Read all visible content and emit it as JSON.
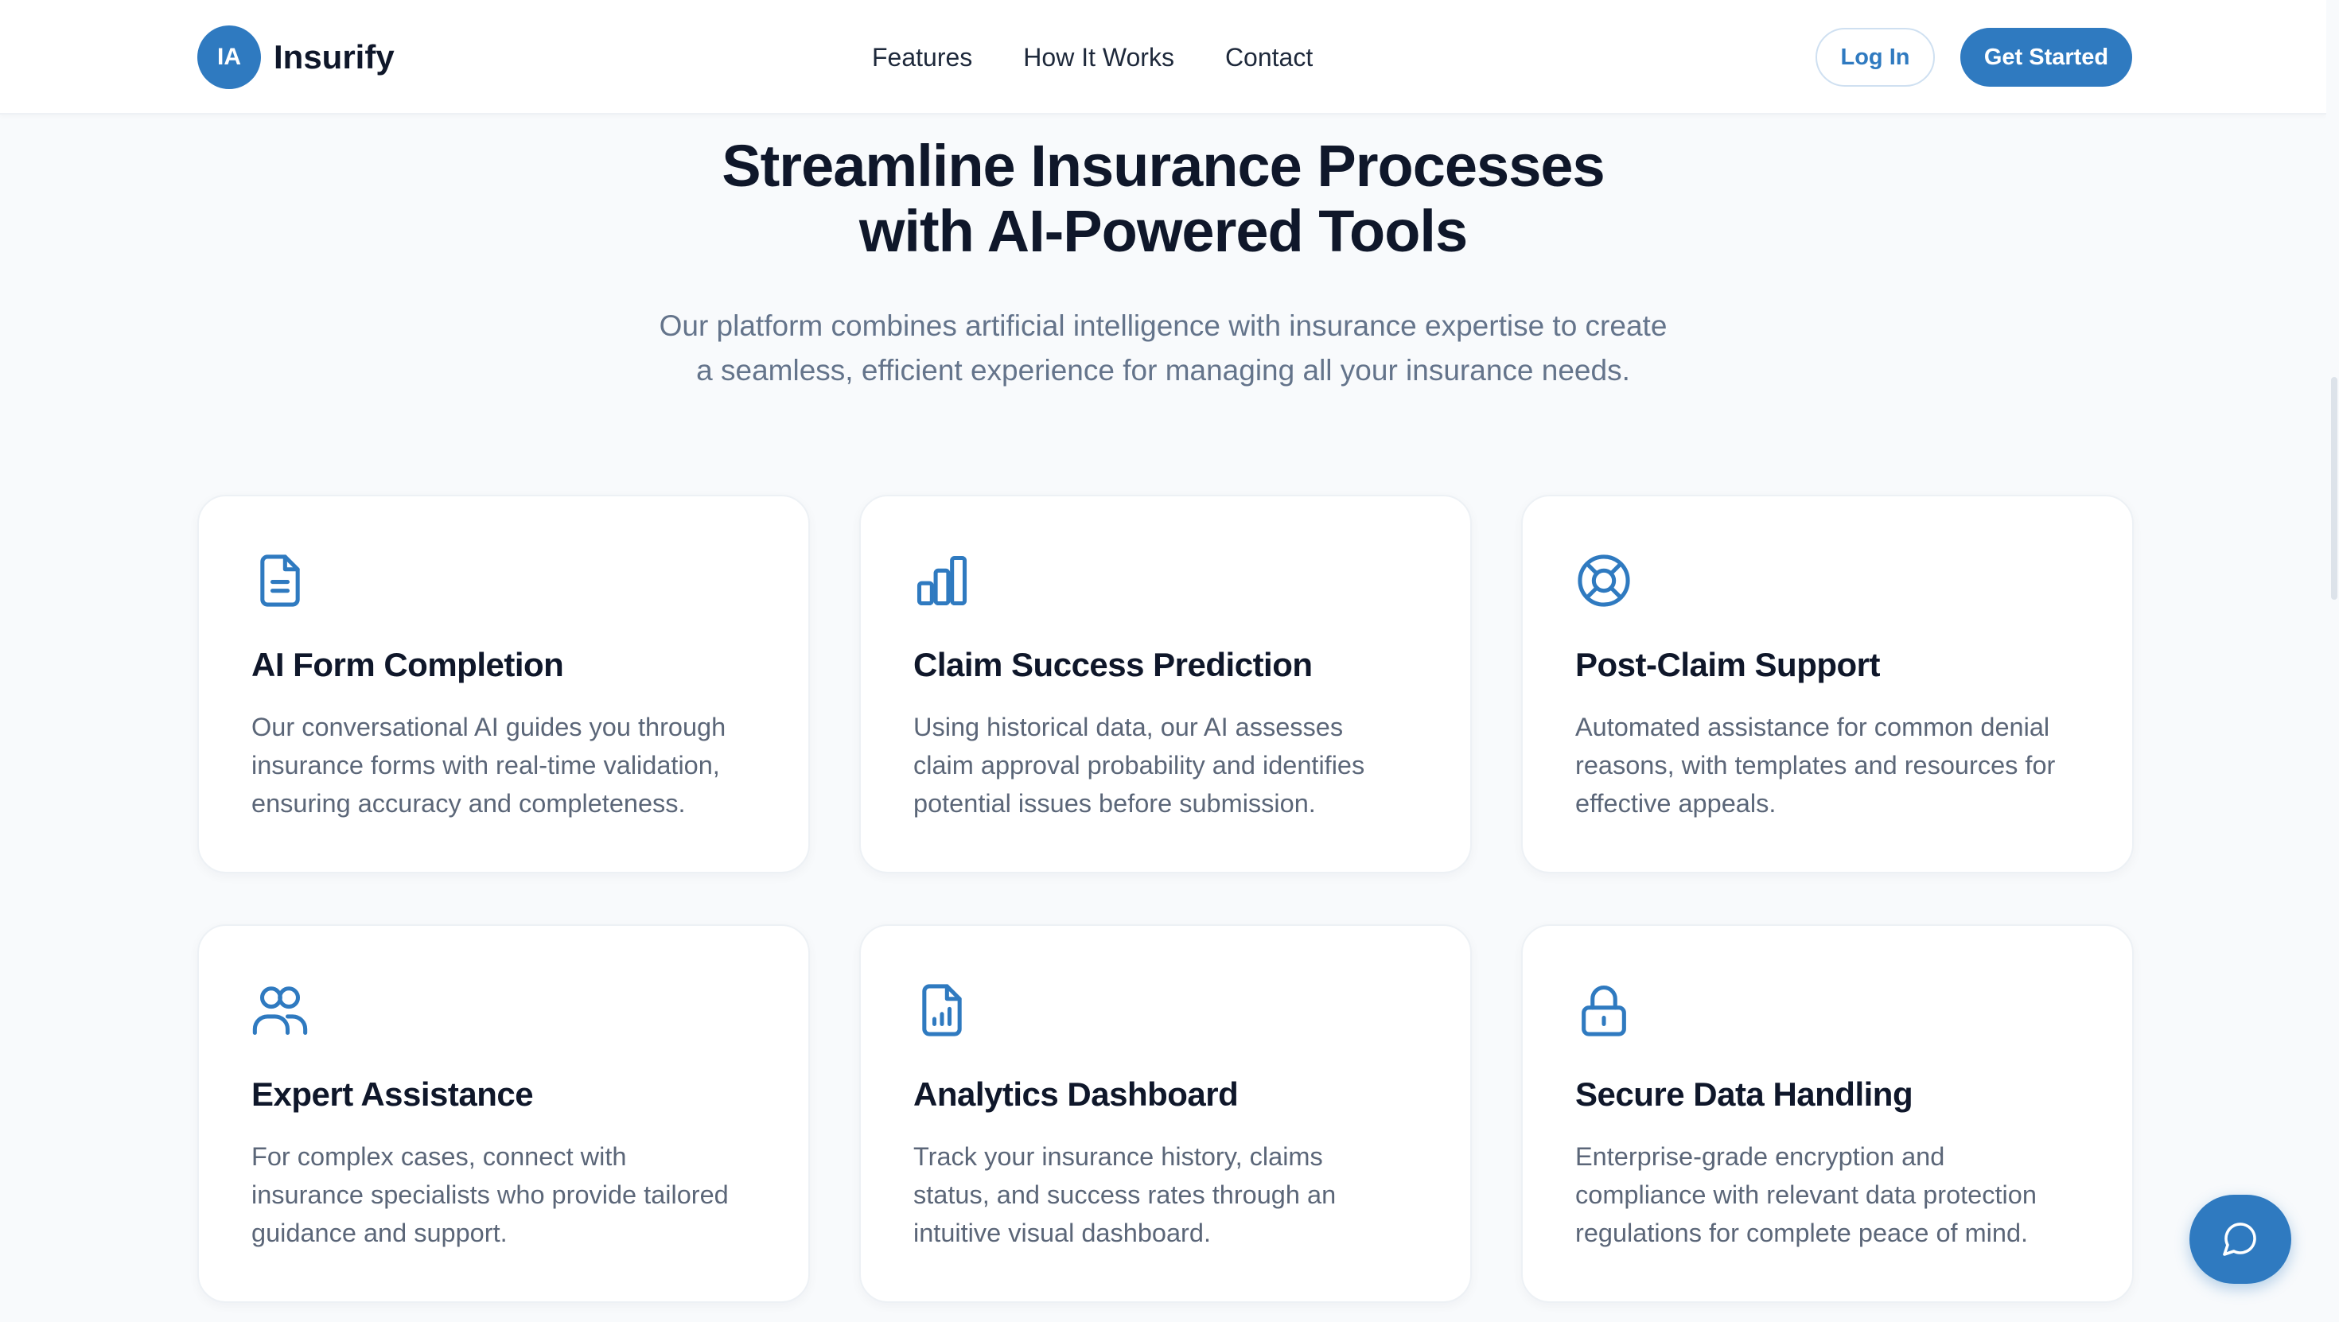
{
  "header": {
    "logo_badge": "IA",
    "brand": "Insurify",
    "nav": [
      "Features",
      "How It Works",
      "Contact"
    ],
    "login_label": "Log In",
    "get_started_label": "Get Started"
  },
  "hero": {
    "title_lines": [
      "Streamline Insurance Processes",
      "with AI-Powered Tools"
    ],
    "subtitle_lines": [
      "Our platform combines artificial intelligence with insurance expertise to create",
      "a seamless, efficient experience for managing all your insurance needs."
    ]
  },
  "features": [
    {
      "icon": "document-icon",
      "title": "AI Form Completion",
      "lines": [
        "Our conversational AI guides you through",
        "insurance forms with real-time validation,",
        "ensuring accuracy and completeness."
      ]
    },
    {
      "icon": "bar-chart-icon",
      "title": "Claim Success Prediction",
      "lines": [
        "Using historical data, our AI assesses",
        "claim approval probability and identifies",
        "potential issues before submission."
      ]
    },
    {
      "icon": "lifebuoy-icon",
      "title": "Post-Claim Support",
      "lines": [
        "Automated assistance for common denial",
        "reasons, with templates and resources for",
        "effective appeals."
      ]
    },
    {
      "icon": "users-icon",
      "title": "Expert Assistance",
      "lines": [
        "For complex cases, connect with",
        "insurance specialists who provide tailored",
        "guidance and support."
      ]
    },
    {
      "icon": "file-chart-icon",
      "title": "Analytics Dashboard",
      "lines": [
        "Track your insurance history, claims",
        "status, and success rates through an",
        "intuitive visual dashboard."
      ]
    },
    {
      "icon": "lock-icon",
      "title": "Secure Data Handling",
      "lines": [
        "Enterprise-grade encryption and",
        "compliance with relevant data protection",
        "regulations for complete peace of mind."
      ]
    }
  ],
  "chat": {
    "icon": "chat-bubble-icon"
  },
  "colors": {
    "accent": "#2f7ac0",
    "background": "#f8fafc",
    "heading": "#0f172a",
    "body_text": "#5b6678"
  }
}
